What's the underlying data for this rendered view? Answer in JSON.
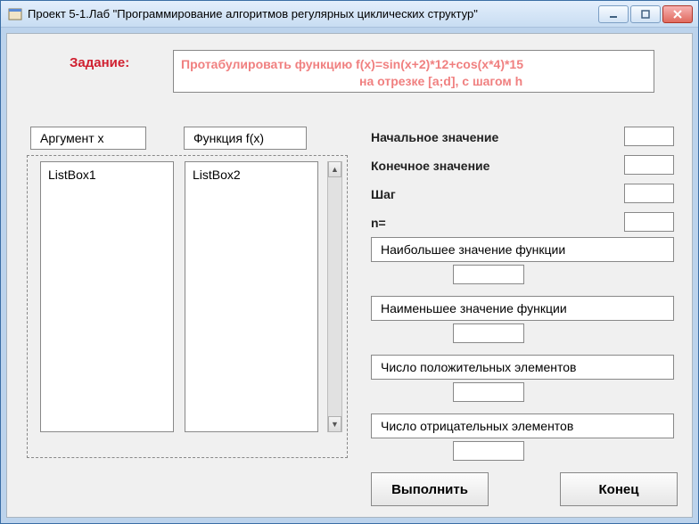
{
  "window": {
    "title": "Проект 5-1.Лаб \"Программирование алгоритмов регулярных циклических  структур\""
  },
  "task": {
    "label": "Задание:",
    "description_line1": "Протабулировать функцию f(x)=sin(x+2)*12+cos(x*4)*15",
    "description_line2": "на отрезке [a;d], с шагом h"
  },
  "labels": {
    "argument": "Аргумент x",
    "function": "Функция f(x)"
  },
  "listboxes": {
    "box1": "ListBox1",
    "box2": "ListBox2"
  },
  "params": {
    "start_label": "Начальное значение",
    "start_value": "",
    "end_label": "Конечное значение",
    "end_value": "",
    "step_label": "Шаг",
    "step_value": "",
    "n_label": "n=",
    "n_value": ""
  },
  "results": {
    "max_label": "Наибольшее значение функции",
    "max_value": "",
    "min_label": "Наименьшее значение функции",
    "min_value": "",
    "pos_label": "Число положительных элементов",
    "pos_value": "",
    "neg_label": "Число отрицательных элементов",
    "neg_value": ""
  },
  "buttons": {
    "execute": "Выполнить",
    "end": "Конец"
  }
}
